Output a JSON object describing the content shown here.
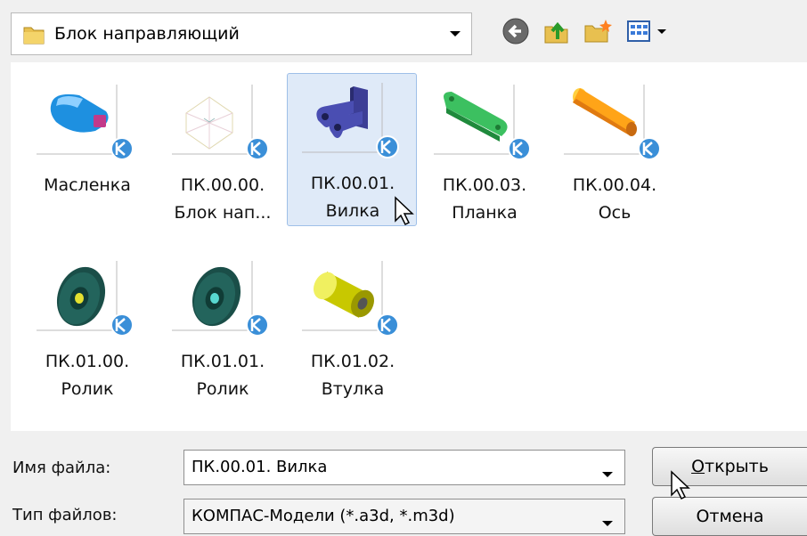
{
  "toolbar": {
    "path": "Блок направляющий",
    "buttons": [
      "back-icon",
      "up-folder-icon",
      "new-folder-icon",
      "view-menu-icon"
    ]
  },
  "files": [
    {
      "line1": "Масленка",
      "line2": "",
      "selected": false,
      "icon": "oiler-thumbnail"
    },
    {
      "line1": "ПК.00.00.",
      "line2": "Блок нап...",
      "selected": false,
      "icon": "assembly-thumbnail"
    },
    {
      "line1": "ПК.00.01.",
      "line2": "Вилка",
      "selected": true,
      "icon": "fork-thumbnail"
    },
    {
      "line1": "ПК.00.03.",
      "line2": "Планка",
      "selected": false,
      "icon": "plate-thumbnail"
    },
    {
      "line1": "ПК.00.04.",
      "line2": "Ось",
      "selected": false,
      "icon": "axle-thumbnail"
    },
    {
      "line1": "ПК.01.00.",
      "line2": "Ролик",
      "selected": false,
      "icon": "roller-thumbnail"
    },
    {
      "line1": "ПК.01.01.",
      "line2": "Ролик",
      "selected": false,
      "icon": "roller-thumbnail"
    },
    {
      "line1": "ПК.01.02.",
      "line2": "Втулка",
      "selected": false,
      "icon": "bushing-thumbnail"
    }
  ],
  "filename": {
    "label": "Имя файла:",
    "value": "ПК.00.01. Вилка"
  },
  "filetype": {
    "label": "Тип файлов:",
    "value": "КОМПАС-Модели (*.a3d, *.m3d)"
  },
  "buttons": {
    "open_hotkey": "О",
    "open_rest": "ткрыть",
    "cancel": "Отмена"
  },
  "colors": {
    "selection": "#dfeaf8",
    "selection_border": "#9ebfe8",
    "badge": "#3a8fd8"
  }
}
